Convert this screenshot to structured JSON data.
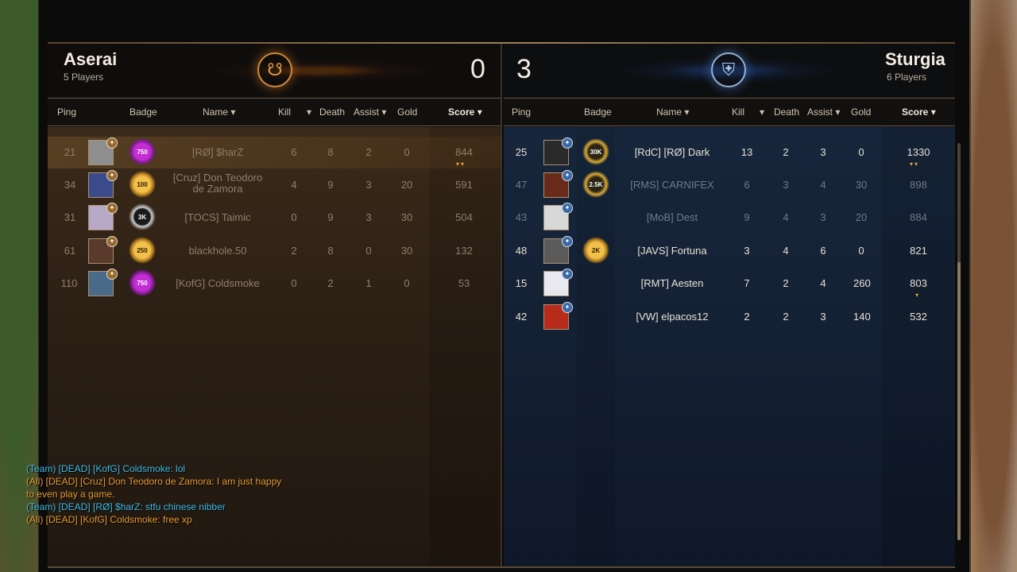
{
  "teams": {
    "left": {
      "name": "Aserai",
      "players": "5 Players",
      "score": "0",
      "emblem": "aserai-emblem-icon",
      "color": "#d28a3a"
    },
    "right": {
      "name": "Sturgia",
      "players": "6 Players",
      "score": "3",
      "emblem": "sturgia-emblem-icon",
      "color": "#8fb2d6"
    }
  },
  "columns": {
    "ping": "Ping",
    "badge": "Badge",
    "name": "Name",
    "kill": "Kill",
    "death": "Death",
    "assist": "Assist",
    "gold": "Gold",
    "score": "Score",
    "sort_arrow": "▾"
  },
  "left_players": [
    {
      "ping": "21",
      "badge": "750",
      "name": "[RØ] $harZ",
      "kill": "6",
      "death": "8",
      "assist": "2",
      "gold": "0",
      "score": "844",
      "trophies": "▾▾"
    },
    {
      "ping": "34",
      "badge": "100",
      "name": "[Cruz] Don Teodoro de Zamora",
      "kill": "4",
      "death": "9",
      "assist": "3",
      "gold": "20",
      "score": "591",
      "trophies": ""
    },
    {
      "ping": "31",
      "badge": "3K",
      "name": "[TOCS] Taimic",
      "kill": "0",
      "death": "9",
      "assist": "3",
      "gold": "30",
      "score": "504",
      "trophies": ""
    },
    {
      "ping": "61",
      "badge": "250",
      "name": "blackhole.50",
      "kill": "2",
      "death": "8",
      "assist": "0",
      "gold": "30",
      "score": "132",
      "trophies": ""
    },
    {
      "ping": "110",
      "badge": "750",
      "name": "[KofG] Coldsmoke",
      "kill": "0",
      "death": "2",
      "assist": "1",
      "gold": "0",
      "score": "53",
      "trophies": ""
    }
  ],
  "right_players": [
    {
      "ping": "25",
      "badge": "30K",
      "name": "[RdC] [RØ] Dark",
      "kill": "13",
      "death": "2",
      "assist": "3",
      "gold": "0",
      "score": "1330",
      "trophies": "▾▾"
    },
    {
      "ping": "47",
      "badge": "2.5K",
      "name": "[RMS] CARNIFEX",
      "kill": "6",
      "death": "3",
      "assist": "4",
      "gold": "30",
      "score": "898",
      "trophies": ""
    },
    {
      "ping": "43",
      "badge": "",
      "name": "[MoB] Dest",
      "kill": "9",
      "death": "4",
      "assist": "3",
      "gold": "20",
      "score": "884",
      "trophies": ""
    },
    {
      "ping": "48",
      "badge": "2K",
      "name": "[JAVS] Fortuna",
      "kill": "3",
      "death": "4",
      "assist": "6",
      "gold": "0",
      "score": "821",
      "trophies": ""
    },
    {
      "ping": "15",
      "badge": "",
      "name": "[RMT] Aesten",
      "kill": "7",
      "death": "2",
      "assist": "4",
      "gold": "260",
      "score": "803",
      "trophies": "▾"
    },
    {
      "ping": "42",
      "badge": "",
      "name": "[VW] elpacos12",
      "kill": "2",
      "death": "2",
      "assist": "3",
      "gold": "140",
      "score": "532",
      "trophies": ""
    }
  ],
  "chat": [
    {
      "channel": "team",
      "text": "(Team) [DEAD] [KofG] Coldsmoke: lol"
    },
    {
      "channel": "all",
      "text": "(All) [DEAD] [Cruz] Don Teodoro de Zamora: I am just happy"
    },
    {
      "channel": "all",
      "text": "to even play a game."
    },
    {
      "channel": "team",
      "text": "(Team) [DEAD] [RØ] $harZ: stfu chinese nibber"
    },
    {
      "channel": "all",
      "text": "(All) [DEAD] [KofG] Coldsmoke: free xp"
    }
  ]
}
